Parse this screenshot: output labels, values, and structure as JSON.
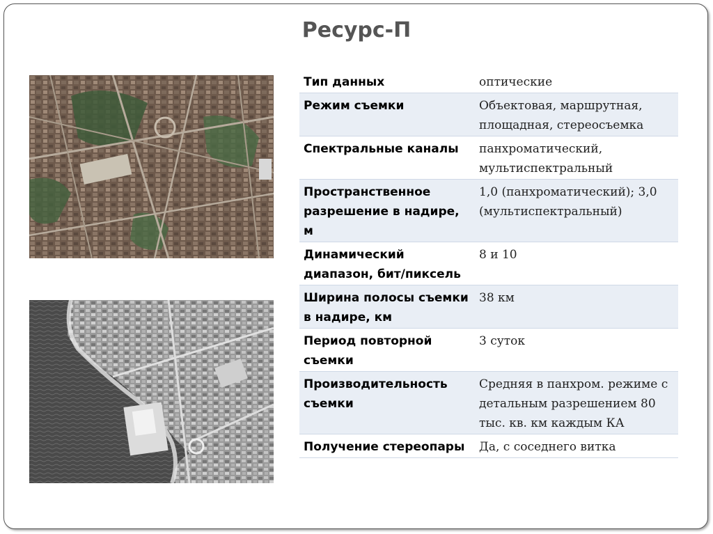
{
  "slide": {
    "title": "Ресурс-П"
  },
  "table": {
    "rows": [
      {
        "label": "Тип данных",
        "value": "оптические"
      },
      {
        "label": "Режим съемки",
        "value": "Объектовая, маршрутная, площадная, стереосъемка"
      },
      {
        "label": "Спектральные каналы",
        "value": "панхроматический, мультиспектральный"
      },
      {
        "label": "Пространственное разрешение в надире, м",
        "value": "1,0 (панхроматический); 3,0 (мультиспектральный)"
      },
      {
        "label": "Динамический диапазон, бит/пиксель",
        "value": "8 и 10"
      },
      {
        "label": "Ширина полосы съемки в надире, км",
        "value": "38 км"
      },
      {
        "label": "Период повторной съемки",
        "value": "3 суток"
      },
      {
        "label": "Производительность съемки",
        "value": "Средняя в панхром. режиме с детальным разрешением 80 тыс. кв. км каждым КА"
      },
      {
        "label": "Получение стереопары",
        "value": "Да, с соседнего витка"
      }
    ]
  },
  "colors": {
    "title": "#555555",
    "row_alt": "#e9eef5",
    "row_border": "#cfd8e6"
  }
}
